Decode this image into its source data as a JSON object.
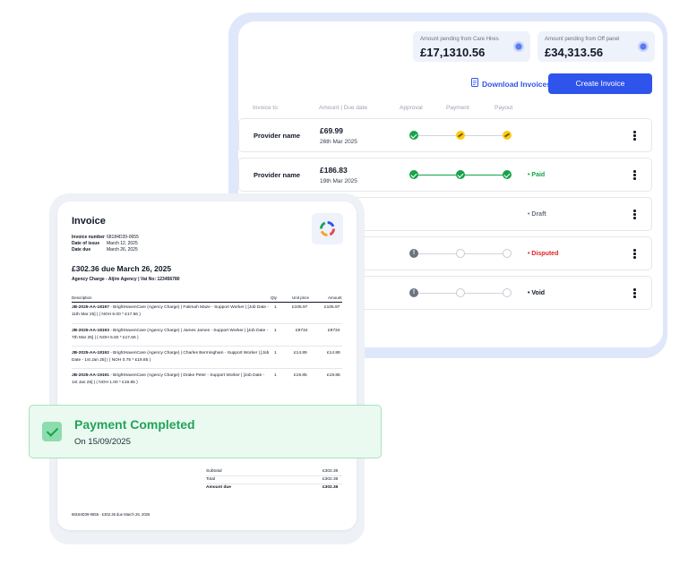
{
  "summary": {
    "care_hires_label": "Amount pending from Care Hires",
    "care_hires_value": "£17,1310.56",
    "off_panel_label": "Amount pending from Off panel",
    "off_panel_value": "£34,313.56"
  },
  "actions": {
    "download_label": "Download Invoices",
    "create_label": "Create Invoice"
  },
  "columns": {
    "invoice_to": "Invoice to",
    "amount_due": "Amount | Due date",
    "approval": "Approval",
    "payment": "Payment",
    "payout": "Payout"
  },
  "rows": [
    {
      "name": "Provider name",
      "amount": "£69.99",
      "date": "26th Mar 2025",
      "status": ""
    },
    {
      "name": "Provider name",
      "amount": "£186.83",
      "date": "19th Mar 2025",
      "status": "• Paid"
    },
    {
      "name": "",
      "amount": "",
      "date": "",
      "status": "• Draft"
    },
    {
      "name": "",
      "amount": "",
      "date": "",
      "status": "• Disputed"
    },
    {
      "name": "",
      "amount": "",
      "date": "",
      "status": "• Void"
    }
  ],
  "status_colors": {
    "paid": "#16a34a",
    "draft": "#6b7280",
    "disputed": "#dc2626",
    "void": "#111827",
    "accent": "#2f54eb"
  },
  "invoice": {
    "title": "Invoice",
    "meta": [
      {
        "label": "Invoice number",
        "value": "68184D39-0655"
      },
      {
        "label": "Date of issue",
        "value": "March 12, 2025"
      },
      {
        "label": "Date due",
        "value": "March 26, 2025"
      }
    ],
    "due_line": "£302.36 due March 26, 2025",
    "agency_line": "Agency Charge - Aljire Agency | Vat No: 123456780",
    "headers": {
      "description": "Description",
      "qty": "Qty",
      "unit_price": "Unit price",
      "amount": "Amount"
    },
    "items": [
      {
        "code": "JB-2025-AA-18197",
        "text": " - BrightHavenCare (Agency Charge) | Fatimah Maze - Support Worker | [Job Date - 11th Mar 25] | ( NOH 6.00 * £17.66 )",
        "qty": "1",
        "unit": "£105.97",
        "amount": "£105.97"
      },
      {
        "code": "JB-2025-AA-18193",
        "text": " - BrightHavenCare (Agency Charge) | James James - Support Worker | [Job Date - 7th Mar 25] | ( NOH 5.50 * £17.66 )",
        "qty": "1",
        "unit": "£9734",
        "amount": "£9734"
      },
      {
        "code": "JB-2025-AA-18192",
        "text": " - BrightHavenCare (Agency Charge) | Charles Bermingham - Support Worker | [Job Date - 1st Jan 25] | ( NOH 0.75 * £19.85 )",
        "qty": "1",
        "unit": "£14.89",
        "amount": "£14.89"
      },
      {
        "code": "JB-2025-AA-19191",
        "text": " - BrightHavenCare (Agency Charge) | Drake Peter - Support Worker | [Job Date - 1st Jan 25] | ( NOH 1.00 * £19.85 )",
        "qty": "1",
        "unit": "£19.85",
        "amount": "£19.85"
      }
    ],
    "totals": [
      {
        "label": "Subtotal",
        "value": "£302.36"
      },
      {
        "label": "Total",
        "value": "£302.36"
      },
      {
        "label": "Amount due",
        "value": "£302.36"
      }
    ],
    "footer": "68184D39-0655 · £302.36 due March 26, 2025"
  },
  "payment_banner": {
    "title": "Payment Completed",
    "date": "On 15/09/2025"
  }
}
